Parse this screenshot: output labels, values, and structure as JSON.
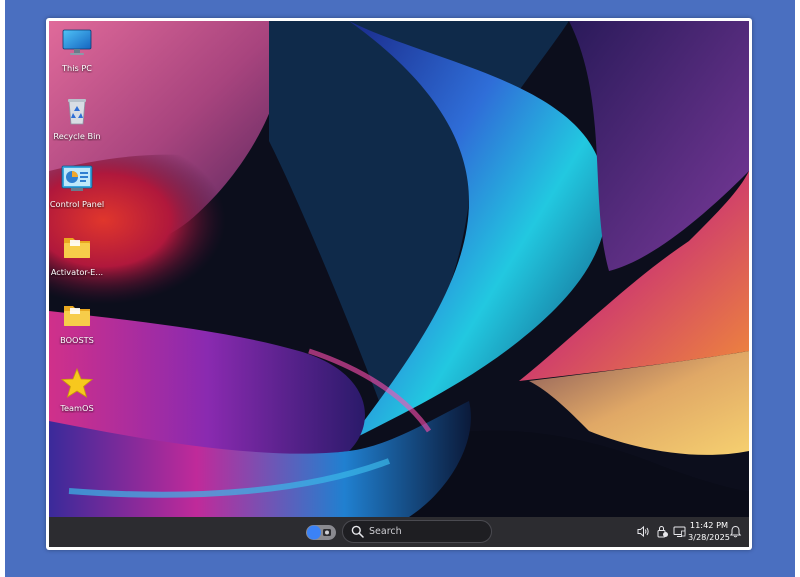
{
  "desktop": {
    "icons": [
      {
        "label": "This PC",
        "icon": "monitor-icon"
      },
      {
        "label": "Recycle Bin",
        "icon": "recycle-bin-icon"
      },
      {
        "label": "Control Panel",
        "icon": "control-panel-icon"
      },
      {
        "label": "Activator-E...",
        "icon": "folder-icon"
      },
      {
        "label": "BOOSTS",
        "icon": "folder-icon"
      },
      {
        "label": "TeamOS",
        "icon": "star-icon"
      }
    ]
  },
  "taskbar": {
    "search_placeholder": "Search",
    "clock_time": "11:42 PM",
    "clock_date": "3/28/2025",
    "tray_icons": [
      "volume-icon",
      "lock-battery-icon",
      "display-icon",
      "notification-bell-icon"
    ]
  },
  "colors": {
    "frame_background": "#4a6fc0",
    "taskbar": "#2c2c30",
    "accent_toggle": "#3b82f6",
    "folder_yellow": "#f2c033",
    "star_yellow": "#f7c81e"
  }
}
